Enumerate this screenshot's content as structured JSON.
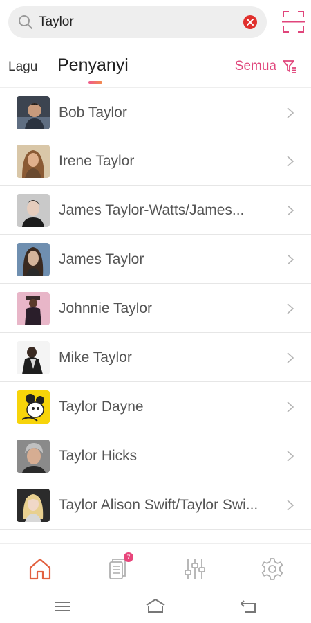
{
  "search": {
    "value": "Taylor",
    "icon": "search-icon",
    "clear_icon": "clear-icon",
    "scan_icon": "scan-icon"
  },
  "tabs": {
    "songs": "Lagu",
    "artists": "Penyanyi",
    "active": "Penyanyi"
  },
  "filter": {
    "label": "Semua",
    "icon": "filter-icon",
    "accent": "#e0457b"
  },
  "artists": [
    {
      "name": "Bob Taylor"
    },
    {
      "name": "Irene Taylor"
    },
    {
      "name": "James Taylor-Watts/James..."
    },
    {
      "name": "James Taylor"
    },
    {
      "name": "Johnnie Taylor"
    },
    {
      "name": "Mike Taylor"
    },
    {
      "name": "Taylor Dayne"
    },
    {
      "name": "Taylor Hicks"
    },
    {
      "name": "Taylor Alison Swift/Taylor Swi..."
    }
  ],
  "bottom_nav": {
    "items": [
      "home-icon",
      "playlist-icon",
      "equalizer-icon",
      "settings-icon"
    ],
    "badge": "7",
    "active": "home-icon",
    "active_color": "#e2603f"
  },
  "system_nav": [
    "menu-icon",
    "home-outline-icon",
    "back-icon"
  ]
}
